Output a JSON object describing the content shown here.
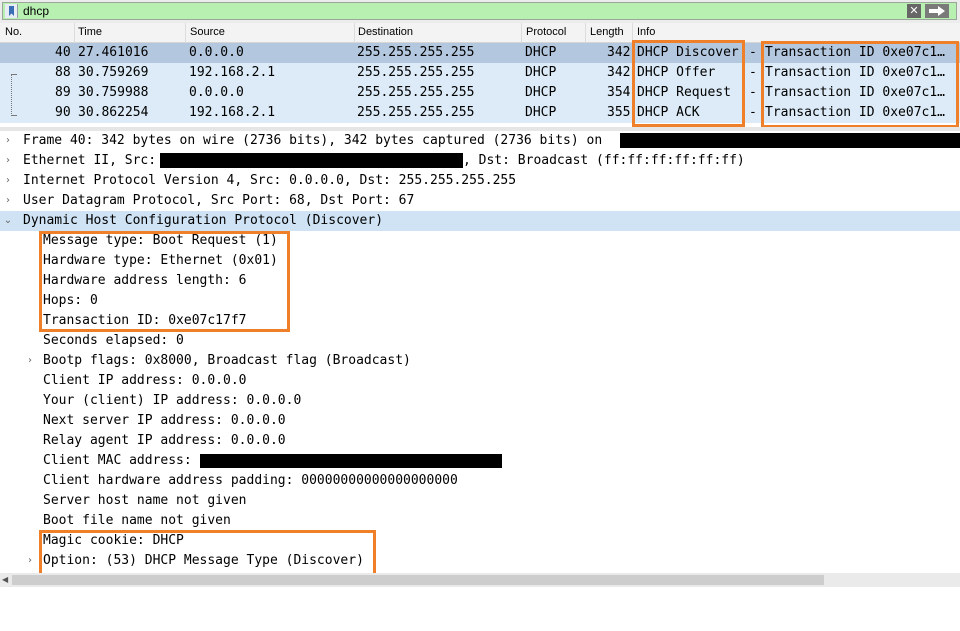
{
  "filter": {
    "value": "dhcp",
    "bookmark_icon": "bookmark-icon",
    "clear_icon": "clear-filter-icon",
    "clear_glyph": "✕",
    "apply_icon": "apply-filter-arrow-icon"
  },
  "packet_list": {
    "columns": [
      "No.",
      "Time",
      "Source",
      "Destination",
      "Protocol",
      "Length",
      "Info"
    ],
    "rows": [
      {
        "no": "40",
        "time": "27.461016",
        "source": "0.0.0.0",
        "destination": "255.255.255.255",
        "protocol": "DHCP",
        "length": "342",
        "info_type": "DHCP Discover",
        "info_dash": "-",
        "info_txn": "Transaction ID 0xe07c1…"
      },
      {
        "no": "88",
        "time": "30.759269",
        "source": "192.168.2.1",
        "destination": "255.255.255.255",
        "protocol": "DHCP",
        "length": "342",
        "info_type": "DHCP Offer",
        "info_dash": "-",
        "info_txn": "Transaction ID 0xe07c1…"
      },
      {
        "no": "89",
        "time": "30.759988",
        "source": "0.0.0.0",
        "destination": "255.255.255.255",
        "protocol": "DHCP",
        "length": "354",
        "info_type": "DHCP Request",
        "info_dash": "-",
        "info_txn": "Transaction ID 0xe07c1…"
      },
      {
        "no": "90",
        "time": "30.862254",
        "source": "192.168.2.1",
        "destination": "255.255.255.255",
        "protocol": "DHCP",
        "length": "355",
        "info_type": "DHCP ACK",
        "info_dash": "-",
        "info_txn": "Transaction ID 0xe07c1…"
      }
    ]
  },
  "details": {
    "frame": "Frame 40: 342 bytes on wire (2736 bits), 342 bytes captured (2736 bits) on",
    "ethernet_prefix": "Ethernet II, Src:",
    "ethernet_suffix": ", Dst: Broadcast (ff:ff:ff:ff:ff:ff)",
    "ip": "Internet Protocol Version 4, Src: 0.0.0.0, Dst: 255.255.255.255",
    "udp": "User Datagram Protocol, Src Port: 68, Dst Port: 67",
    "dhcp": "Dynamic Host Configuration Protocol (Discover)",
    "fields": [
      "Message type: Boot Request (1)",
      "Hardware type: Ethernet (0x01)",
      "Hardware address length: 6",
      "Hops: 0",
      "Transaction ID: 0xe07c17f7",
      "Seconds elapsed: 0",
      "Bootp flags: 0x8000, Broadcast flag (Broadcast)",
      "Client IP address: 0.0.0.0",
      "Your (client) IP address: 0.0.0.0",
      "Next server IP address: 0.0.0.0",
      "Relay agent IP address: 0.0.0.0",
      "Client MAC address:",
      "Client hardware address padding: 00000000000000000000",
      "Server host name not given",
      "Boot file name not given",
      "Magic cookie: DHCP",
      "Option: (53) DHCP Message Type (Discover)"
    ],
    "arrow_collapsed": "›",
    "arrow_expanded": "⌄"
  },
  "colors": {
    "filter_valid": "#b8f0b2",
    "selected_row": "#b3c7de",
    "related_row": "#dcebf7",
    "highlight": "#f07f29"
  }
}
